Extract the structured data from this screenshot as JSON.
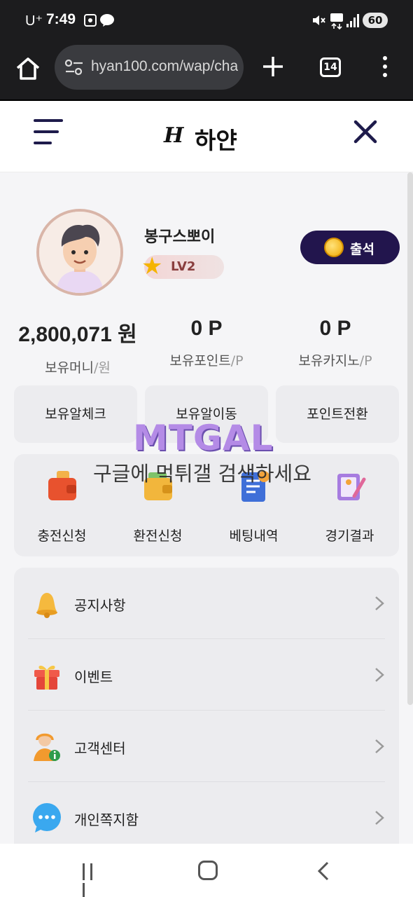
{
  "status_bar": {
    "carrier": "U⁺",
    "time": "7:49",
    "battery": "60"
  },
  "browser": {
    "url": "hyan100.com/wap/cha",
    "tab_count": "14"
  },
  "header": {
    "logo_mark": "H",
    "logo_text": "하얀"
  },
  "profile": {
    "username": "봉구스뽀이",
    "level": "LV2",
    "attendance_label": "출석"
  },
  "balances": [
    {
      "value": "2,800,071 원",
      "label": "보유머니",
      "unit": "/원"
    },
    {
      "value": "0 P",
      "label": "보유포인트",
      "unit": "/P"
    },
    {
      "value": "0 P",
      "label": "보유카지노",
      "unit": "/P"
    }
  ],
  "quick_buttons": [
    "보유알체크",
    "보유알이동",
    "포인트전환"
  ],
  "services": [
    "충전신청",
    "환전신청",
    "베팅내역",
    "경기결과"
  ],
  "menu": [
    {
      "label": "공지사항",
      "icon": "bell-icon"
    },
    {
      "label": "이벤트",
      "icon": "gift-icon"
    },
    {
      "label": "고객센터",
      "icon": "support-agent-icon"
    },
    {
      "label": "개인쪽지함",
      "icon": "chat-bubble-icon"
    }
  ],
  "watermark": {
    "logo": "MTGAL",
    "caption": "구글에 먹튀갤 검색하세요"
  },
  "colors": {
    "accent": "#22154d",
    "chrome": "#1c1c1e",
    "card": "#ececef"
  }
}
